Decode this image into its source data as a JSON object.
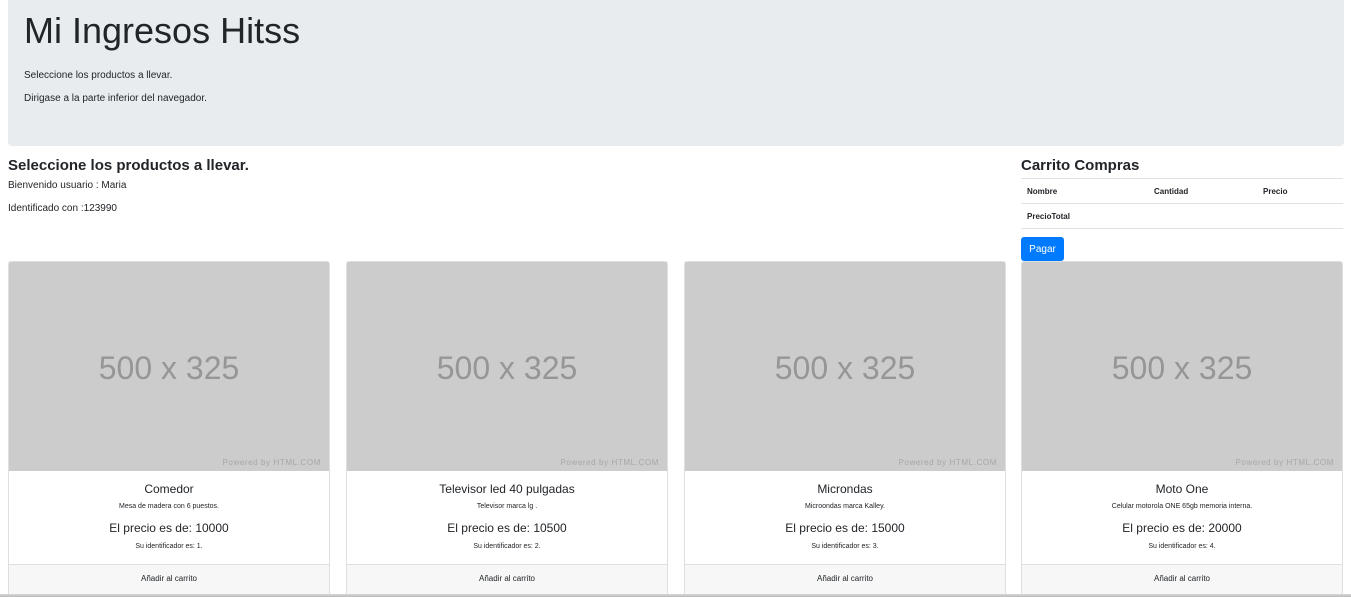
{
  "header": {
    "title": "Mi Ingresos Hitss",
    "line1": "Seleccione los productos a llevar.",
    "line2": "Dirigase a la parte inferior del navegador."
  },
  "main": {
    "title": "Seleccione los productos a llevar.",
    "welcome": "Bienvenido usuario : Maria",
    "identified": "Identificado con :123990"
  },
  "cart": {
    "title": "Carrito Compras",
    "columns": [
      "Nombre",
      "Cantidad",
      "Precio"
    ],
    "total_label": "PrecioTotal",
    "pay_label": "Pagar"
  },
  "products": [
    {
      "image_text": "500 x 325",
      "image_credit": "Powered by HTML.COM",
      "name": "Comedor",
      "description": "Mesa de madera con 6 puestos.",
      "price": "El precio es de: 10000",
      "id_text": "Su identificador es: 1.",
      "add_label": "Añadir al carrito"
    },
    {
      "image_text": "500 x 325",
      "image_credit": "Powered by HTML.COM",
      "name": "Televisor led 40 pulgadas",
      "description": "Televisor marca lg .",
      "price": "El precio es de: 10500",
      "id_text": "Su identificador es: 2.",
      "add_label": "Añadir al carrito"
    },
    {
      "image_text": "500 x 325",
      "image_credit": "Powered by HTML.COM",
      "name": "Microndas",
      "description": "Microondas marca Kalley.",
      "price": "El precio es de: 15000",
      "id_text": "Su identificador es: 3.",
      "add_label": "Añadir al carrito"
    },
    {
      "image_text": "500 x 325",
      "image_credit": "Powered by HTML.COM",
      "name": "Moto One",
      "description": "Celular motorola ONE 65gb memoria interna.",
      "price": "El precio es de: 20000",
      "id_text": "Su identificador es: 4.",
      "add_label": "Añadir al carrito"
    }
  ],
  "colors": {
    "jumbotron_bg": "#e9ecef",
    "primary": "#007bff",
    "placeholder_bg": "#cccccc"
  }
}
